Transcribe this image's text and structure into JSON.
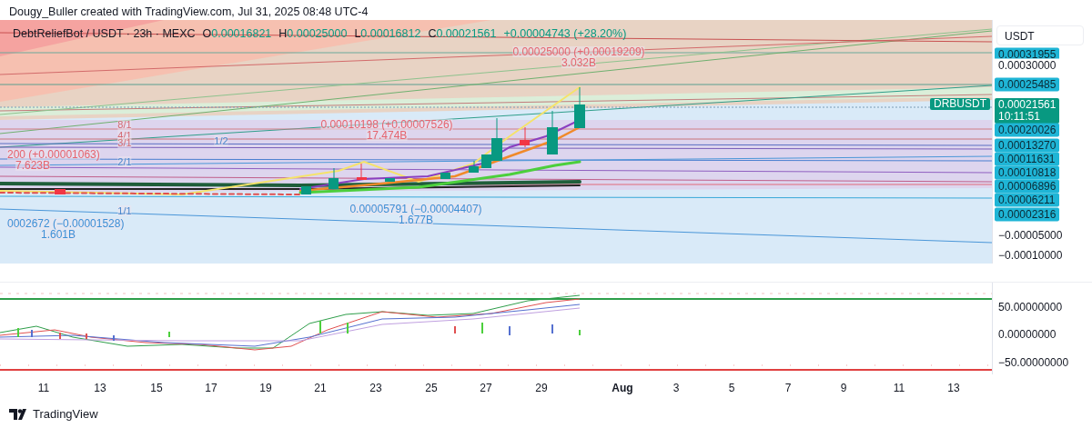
{
  "header": {
    "credit": "Dougy_Buller created with TradingView.com, Jul 31, 2025 08:48 UTC-4"
  },
  "legend": {
    "symbol": "DebtReliefBot / USDT · 23h · MEXC",
    "ohlc": [
      {
        "key": "O",
        "value": "0.00016821"
      },
      {
        "key": "H",
        "value": "0.00025000"
      },
      {
        "key": "L",
        "value": "0.00016812"
      },
      {
        "key": "C",
        "value": "0.00021561"
      }
    ],
    "change": "+0.00004743 (+28.20%)"
  },
  "annotations": [
    {
      "kind": "high",
      "price": "0.00025000 (+0.00019209)",
      "volume": "3.032B"
    },
    {
      "kind": "high",
      "price": "0.00010198 (+0.00007526)",
      "volume": "17.474B"
    },
    {
      "kind": "high",
      "price": "200 (+0.00001063)",
      "volume": "7.623B"
    },
    {
      "kind": "low",
      "price": "0.00005791 (−0.00004407)",
      "volume": "1.677B"
    },
    {
      "kind": "low",
      "price": "0002672 (−0.00001528)",
      "volume": "1.601B"
    }
  ],
  "ratio_labels": [
    {
      "kind": "upper",
      "text": "8/1"
    },
    {
      "kind": "upper",
      "text": "4/1"
    },
    {
      "kind": "upper",
      "text": "3/1"
    },
    {
      "kind": "lower",
      "text": "1/2"
    },
    {
      "kind": "lower",
      "text": "2/1"
    },
    {
      "kind": "lower",
      "text": "1/1"
    }
  ],
  "symbol_tag": "DRBUSDT",
  "price_axis": {
    "currency": "USDT",
    "labels": [
      {
        "kind": "tag",
        "text": "0.00031955"
      },
      {
        "kind": "plain",
        "text": "0.00030000"
      },
      {
        "kind": "tag",
        "text": "0.00025485"
      },
      {
        "kind": "last",
        "text": "0.00021561",
        "countdown": "10:11:51"
      },
      {
        "kind": "tag",
        "text": "0.00020026"
      },
      {
        "kind": "tag",
        "text": "0.00013270"
      },
      {
        "kind": "tag",
        "text": "0.00011631"
      },
      {
        "kind": "tag",
        "text": "0.00010818"
      },
      {
        "kind": "tag",
        "text": "0.00006896"
      },
      {
        "kind": "tag",
        "text": "0.00006211"
      },
      {
        "kind": "tag",
        "text": "0.00002316"
      },
      {
        "kind": "plain",
        "text": "−0.00005000"
      },
      {
        "kind": "plain",
        "text": "−0.00010000"
      }
    ]
  },
  "oscillator_axis": {
    "labels": [
      "50.00000000",
      "0.00000000",
      "−50.00000000"
    ]
  },
  "time_axis": {
    "labels": [
      {
        "kind": "day",
        "text": "11"
      },
      {
        "kind": "day",
        "text": "13"
      },
      {
        "kind": "day",
        "text": "15"
      },
      {
        "kind": "day",
        "text": "17"
      },
      {
        "kind": "day",
        "text": "19"
      },
      {
        "kind": "day",
        "text": "21"
      },
      {
        "kind": "day",
        "text": "23"
      },
      {
        "kind": "day",
        "text": "25"
      },
      {
        "kind": "day",
        "text": "27"
      },
      {
        "kind": "day",
        "text": "29"
      },
      {
        "kind": "month",
        "text": "Aug"
      },
      {
        "kind": "day",
        "text": "3"
      },
      {
        "kind": "day",
        "text": "5"
      },
      {
        "kind": "day",
        "text": "7"
      },
      {
        "kind": "day",
        "text": "9"
      },
      {
        "kind": "day",
        "text": "11"
      },
      {
        "kind": "day",
        "text": "13"
      }
    ]
  },
  "footer": {
    "brand": "TradingView"
  }
}
